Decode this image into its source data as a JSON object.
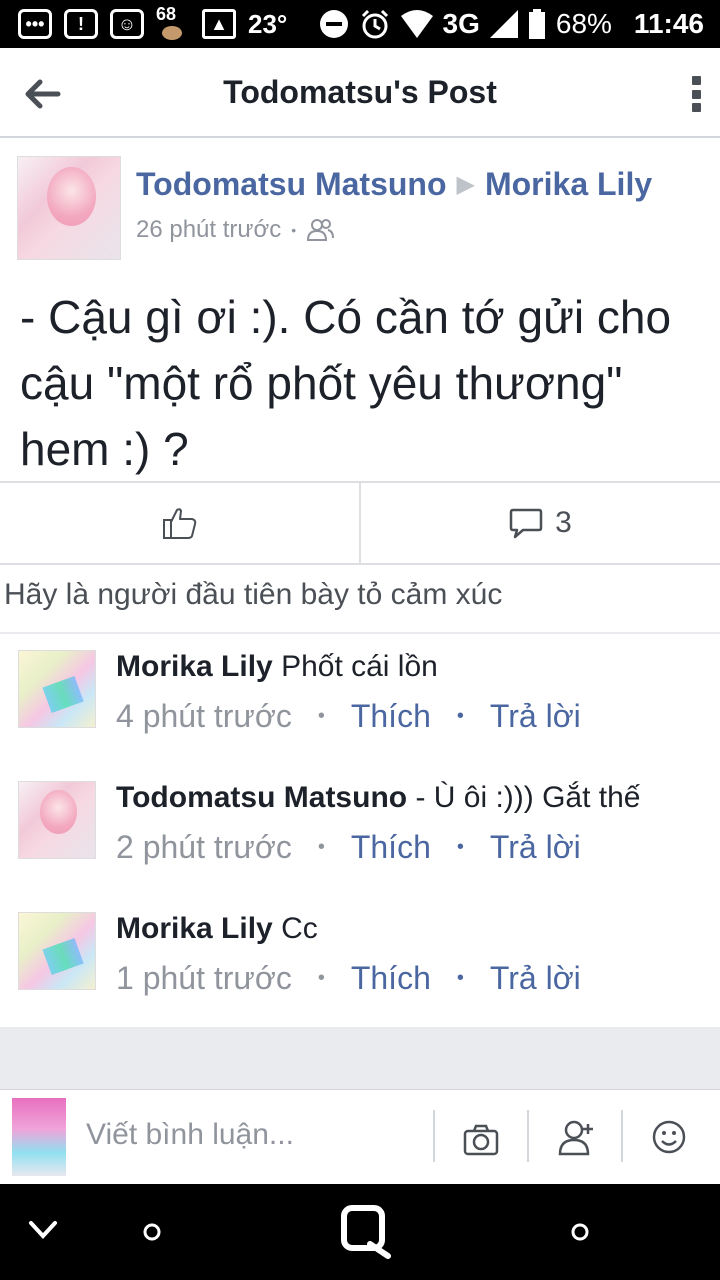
{
  "status_bar": {
    "notif_count": "68",
    "temperature": "23°",
    "network": "3G",
    "battery": "68%",
    "time": "11:46"
  },
  "app_bar": {
    "title": "Todomatsu's Post"
  },
  "post": {
    "author": "Todomatsu Matsuno",
    "target": "Morika Lily",
    "time": "26 phút trước",
    "body": "- Cậu gì ơi :). Có cần tớ gửi cho cậu \"một rổ phốt yêu thương\" hem :) ?",
    "comment_count": "3"
  },
  "reactions_prompt": "Hãy là người đầu tiên bày tỏ cảm xúc",
  "comments": [
    {
      "author": "Morika Lily",
      "text": "Phốt cái lồn",
      "time": "4 phút trước",
      "like": "Thích",
      "reply": "Trả lời"
    },
    {
      "author": "Todomatsu Matsuno",
      "text": "- Ù ôi :))) Gắt thế",
      "time": "2 phút trước",
      "like": "Thích",
      "reply": "Trả lời"
    },
    {
      "author": "Morika Lily",
      "text": "Cc",
      "time": "1 phút trước",
      "like": "Thích",
      "reply": "Trả lời"
    }
  ],
  "composer": {
    "placeholder": "Viết bình luận..."
  },
  "colors": {
    "link": "#4b67a1",
    "muted": "#90949c",
    "text": "#1d2129"
  }
}
